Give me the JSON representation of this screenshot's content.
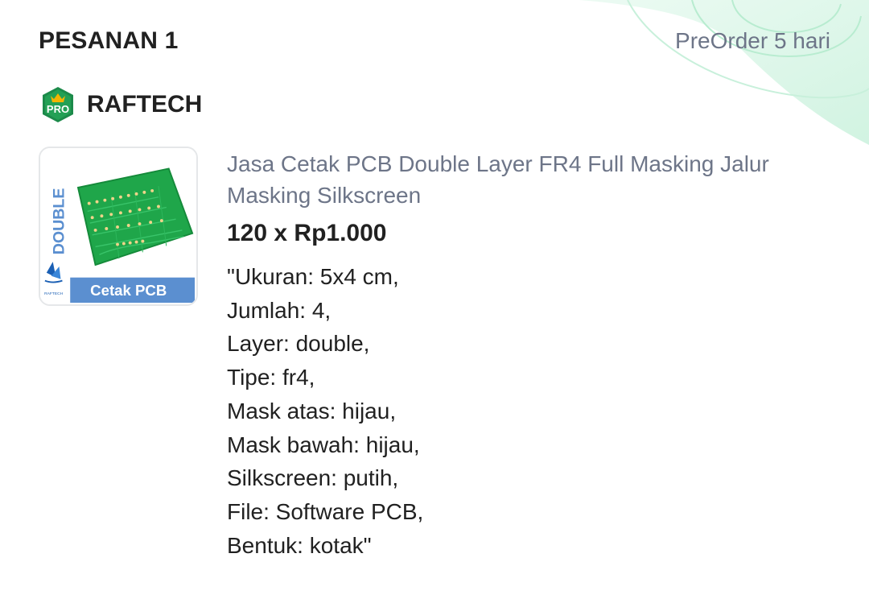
{
  "order": {
    "title": "PESANAN 1",
    "status": "PreOrder 5 hari"
  },
  "shop": {
    "badge_icon": "pro-badge-icon",
    "badge_text": "PRO",
    "name": "RAFTECH"
  },
  "product": {
    "image_icon": "pcb-product-image",
    "image_side_text": "DOUBLE",
    "image_caption": "Cetak PCB",
    "image_logo_text": "RAFTECH",
    "name": "Jasa Cetak PCB Double Layer FR4 Full Masking Jalur Masking Silkscreen",
    "quantity_price": "120 x Rp1.000",
    "notes": [
      "\"Ukuran: 5x4 cm,",
      "Jumlah: 4,",
      "Layer: double,",
      "Tipe: fr4,",
      "Mask atas: hijau,",
      "Mask bawah: hijau,",
      "Silkscreen: putih,",
      "File: Software PCB,",
      "Bentuk: kotak\""
    ]
  },
  "colors": {
    "badge_green": "#1c8a4a",
    "badge_gold": "#f4b400",
    "pcb_green": "#1fa64a",
    "caption_blue": "#5b8fd0",
    "muted_text": "#6d7588",
    "text": "#212121"
  }
}
